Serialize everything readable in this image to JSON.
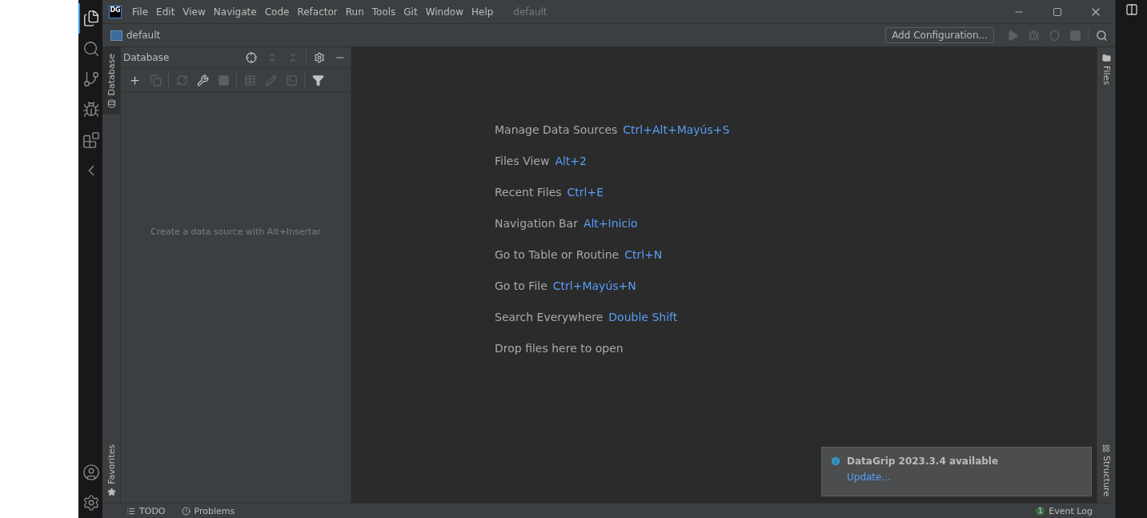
{
  "activity_bar": {
    "items": [
      {
        "kind": "files",
        "selected": true
      },
      {
        "kind": "search",
        "selected": false
      },
      {
        "kind": "branch",
        "selected": false
      },
      {
        "kind": "debug",
        "selected": false
      },
      {
        "kind": "extensions",
        "selected": false
      },
      {
        "kind": "back",
        "selected": false
      }
    ],
    "bottom": [
      {
        "kind": "account"
      },
      {
        "kind": "settings"
      }
    ]
  },
  "window": {
    "logo": "DG",
    "menu": [
      "File",
      "Edit",
      "View",
      "Navigate",
      "Code",
      "Refactor",
      "Run",
      "Tools",
      "Git",
      "Window",
      "Help"
    ],
    "title": "default"
  },
  "navbar": {
    "project": "default",
    "run_config": "Add Configuration...",
    "tools": [
      {
        "kind": "run",
        "disabled": true
      },
      {
        "kind": "debug",
        "disabled": true
      },
      {
        "kind": "coverage",
        "disabled": true
      },
      {
        "kind": "stop",
        "disabled": true
      },
      {
        "kind": "search",
        "disabled": false
      }
    ]
  },
  "left_tabs": [
    {
      "label": "Database",
      "kind": "database",
      "selected": true
    },
    {
      "label": "Favorites",
      "kind": "favorites",
      "selected": false
    }
  ],
  "database_panel": {
    "title": "Database",
    "header_tools": [
      {
        "kind": "locate",
        "disabled": false
      },
      {
        "kind": "expand",
        "disabled": true
      },
      {
        "kind": "collapse",
        "disabled": true
      },
      {
        "kind": "settings",
        "disabled": false
      },
      {
        "kind": "hide",
        "disabled": false
      }
    ],
    "toolbar": [
      {
        "kind": "add",
        "disabled": false
      },
      {
        "kind": "copy",
        "disabled": true
      },
      {
        "kind": "refresh",
        "disabled": true
      },
      {
        "kind": "properties",
        "disabled": false
      },
      {
        "kind": "stop",
        "disabled": true
      },
      {
        "kind": "table",
        "disabled": true
      },
      {
        "kind": "edit",
        "disabled": true
      },
      {
        "kind": "console",
        "disabled": true
      },
      {
        "kind": "filter",
        "disabled": false
      }
    ],
    "empty_text": "Create a data source with Alt+Insertar"
  },
  "hints": [
    {
      "action": "Manage Data Sources",
      "shortcut": "Ctrl+Alt+Mayús+S"
    },
    {
      "action": "Files View",
      "shortcut": "Alt+2"
    },
    {
      "action": "Recent Files",
      "shortcut": "Ctrl+E"
    },
    {
      "action": "Navigation Bar",
      "shortcut": "Alt+Inicio"
    },
    {
      "action": "Go to Table or Routine",
      "shortcut": "Ctrl+N"
    },
    {
      "action": "Go to File",
      "shortcut": "Ctrl+Mayús+N"
    },
    {
      "action": "Search Everywhere",
      "shortcut": "Double Shift"
    },
    {
      "action": "Drop files here to open"
    }
  ],
  "right_tabs": [
    {
      "label": "Files",
      "kind": "files"
    },
    {
      "label": "Structure",
      "kind": "structure"
    }
  ],
  "notification": {
    "title": "DataGrip 2023.3.4 available",
    "link": "Update..."
  },
  "status_bar": {
    "items": [
      {
        "label": "TODO",
        "kind": "todo"
      },
      {
        "label": "Problems",
        "kind": "problems"
      }
    ],
    "event_log": {
      "count": "1",
      "label": "Event Log"
    }
  }
}
